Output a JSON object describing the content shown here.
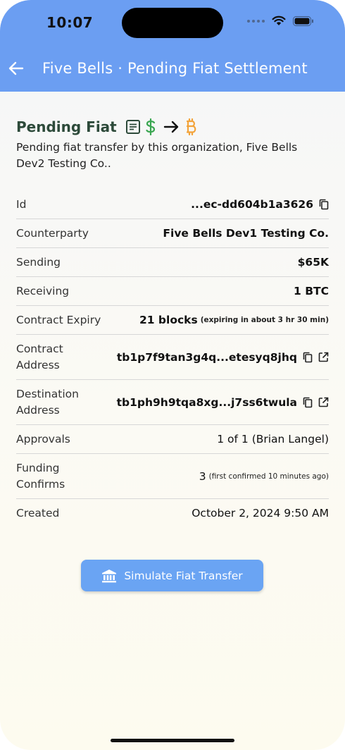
{
  "status_bar": {
    "time": "10:07"
  },
  "nav": {
    "title": "Five Bells · Pending Fiat Settlement"
  },
  "section": {
    "title": "Pending Fiat",
    "description": "Pending fiat transfer by this organization, Five Bells Dev2 Testing Co.."
  },
  "details": {
    "id": {
      "label": "Id",
      "value": "...ec-dd604b1a3626"
    },
    "counterparty": {
      "label": "Counterparty",
      "value": "Five Bells Dev1 Testing Co."
    },
    "sending": {
      "label": "Sending",
      "value": "$65K"
    },
    "receiving": {
      "label": "Receiving",
      "value": "1 BTC"
    },
    "contract_expiry": {
      "label": "Contract Expiry",
      "value": "21 blocks",
      "note": "(expiring in about 3 hr 30 min)"
    },
    "contract_address": {
      "label_line1": "Contract",
      "label_line2": "Address",
      "value": "tb1p7f9tan3g4q...etesyq8jhq"
    },
    "destination_address": {
      "label_line1": "Destination",
      "label_line2": "Address",
      "value": "tb1ph9h9tqa8xg...j7ss6twula"
    },
    "approvals": {
      "label": "Approvals",
      "value": "1 of 1 (Brian Langel)"
    },
    "funding_confirms": {
      "label_line1": "Funding",
      "label_line2": "Confirms",
      "value": "3",
      "note": "(first confirmed 10 minutes ago)"
    },
    "created": {
      "label": "Created",
      "value": "October 2, 2024 9:50 AM"
    }
  },
  "cta": {
    "label": "Simulate Fiat Transfer"
  },
  "colors": {
    "header": "#6b9ef2",
    "cta": "#6aa4f3",
    "dollar": "#3aa651",
    "bitcoin": "#f3a33a",
    "title": "#2d4a3a"
  },
  "icons": {
    "back": "arrow-left-icon",
    "document": "document-icon",
    "dollar": "dollar-icon",
    "arrow": "arrow-right-icon",
    "bitcoin": "bitcoin-icon",
    "copy": "copy-icon",
    "external_link": "external-link-icon",
    "bank": "bank-icon"
  }
}
